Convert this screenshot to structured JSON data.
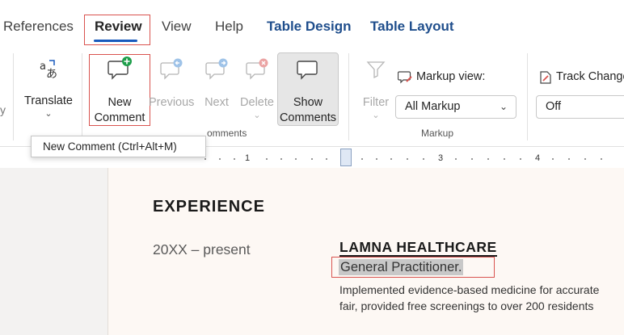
{
  "tabs": {
    "references": "References",
    "review": "Review",
    "view": "View",
    "help": "Help",
    "table_design": "Table Design",
    "table_layout": "Table Layout"
  },
  "ribbon": {
    "translate": {
      "label": "Translate",
      "icon": "translate-icon"
    },
    "new_comment": {
      "line1": "New",
      "line2": "Comment",
      "icon": "new-comment-icon"
    },
    "previous": {
      "label": "Previous",
      "icon": "previous-comment-icon"
    },
    "next": {
      "label": "Next",
      "icon": "next-comment-icon"
    },
    "delete": {
      "label": "Delete",
      "icon": "delete-comment-icon"
    },
    "show_comments": {
      "line1": "Show",
      "line2": "Comments",
      "icon": "show-comments-icon"
    },
    "comments_group_label": "omments",
    "filter": {
      "label": "Filter",
      "icon": "filter-icon"
    },
    "markup_view": {
      "label": "Markup view:",
      "selected": "All Markup",
      "icon": "markup-view-icon"
    },
    "markup_group_label": "Markup",
    "track_changes": {
      "label": "Track Changes",
      "selected": "Off",
      "icon": "track-changes-icon"
    }
  },
  "tooltip": {
    "text": "New Comment (Ctrl+Alt+M)"
  },
  "ruler": {
    "numbers": [
      "1",
      "3",
      "4"
    ]
  },
  "document": {
    "heading": "EXPERIENCE",
    "date_range": "20XX – present",
    "company": "LAMNA HEALTHCARE",
    "role": "General Practitioner.",
    "description_line1": "Implemented evidence-based medicine for accurate",
    "description_line2": "fair, provided free screenings to over 200 residents"
  },
  "colors": {
    "accent": "#185abd",
    "contextual_tab": "#1f4e8c",
    "highlight_box": "#d9534f",
    "new_comment_badge": "#1e9e4a",
    "delete_badge": "#e06666",
    "nav_badge": "#4a90d9",
    "page_background": "#fdf8f4"
  }
}
